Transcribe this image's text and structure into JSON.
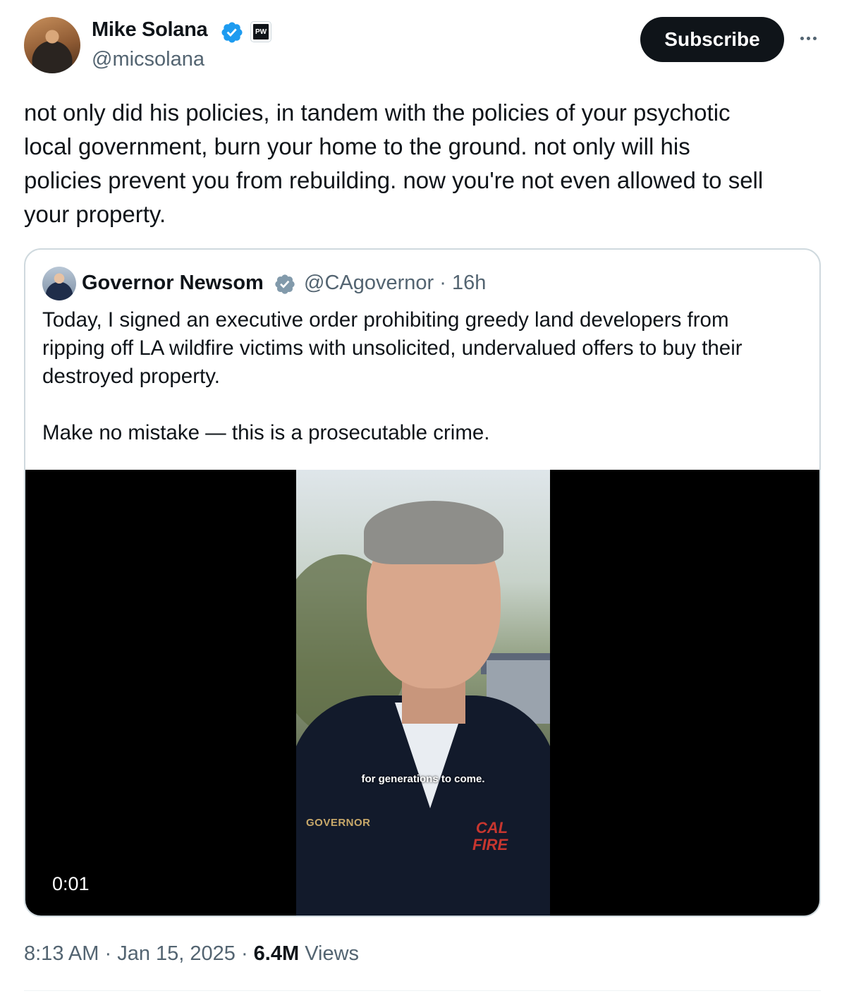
{
  "author": {
    "name": "Mike Solana",
    "handle": "@micsolana",
    "affiliation_badge": "PW"
  },
  "header": {
    "subscribe_label": "Subscribe"
  },
  "tweet": {
    "text": "not only did his policies, in tandem with the policies of your psychotic\nlocal government, burn your home to the ground. not only will his\npolicies prevent you from rebuilding. now you're not even allowed to sell\nyour property."
  },
  "quote": {
    "name": "Governor Newsom",
    "handle": "@CAgovernor",
    "time": "16h",
    "text": "Today, I signed an executive order prohibiting greedy land developers from\nripping off LA wildfire victims with unsolicited, undervalued offers to buy their\ndestroyed property.\n\nMake no mistake — this is a prosecutable crime.",
    "video": {
      "subtitle": "for generations to come.",
      "jacket_text": "GOVERNOR",
      "patch_line1": "CAL",
      "patch_line2": "FIRE",
      "timecode": "0:01"
    }
  },
  "meta": {
    "time": "8:13 AM",
    "date": "Jan 15, 2025",
    "views_count": "6.4M",
    "views_label": "Views"
  },
  "colors": {
    "verified": "#1d9bf0",
    "gray_verified": "#829aab",
    "text": "#0f1419",
    "secondary": "#536471"
  }
}
